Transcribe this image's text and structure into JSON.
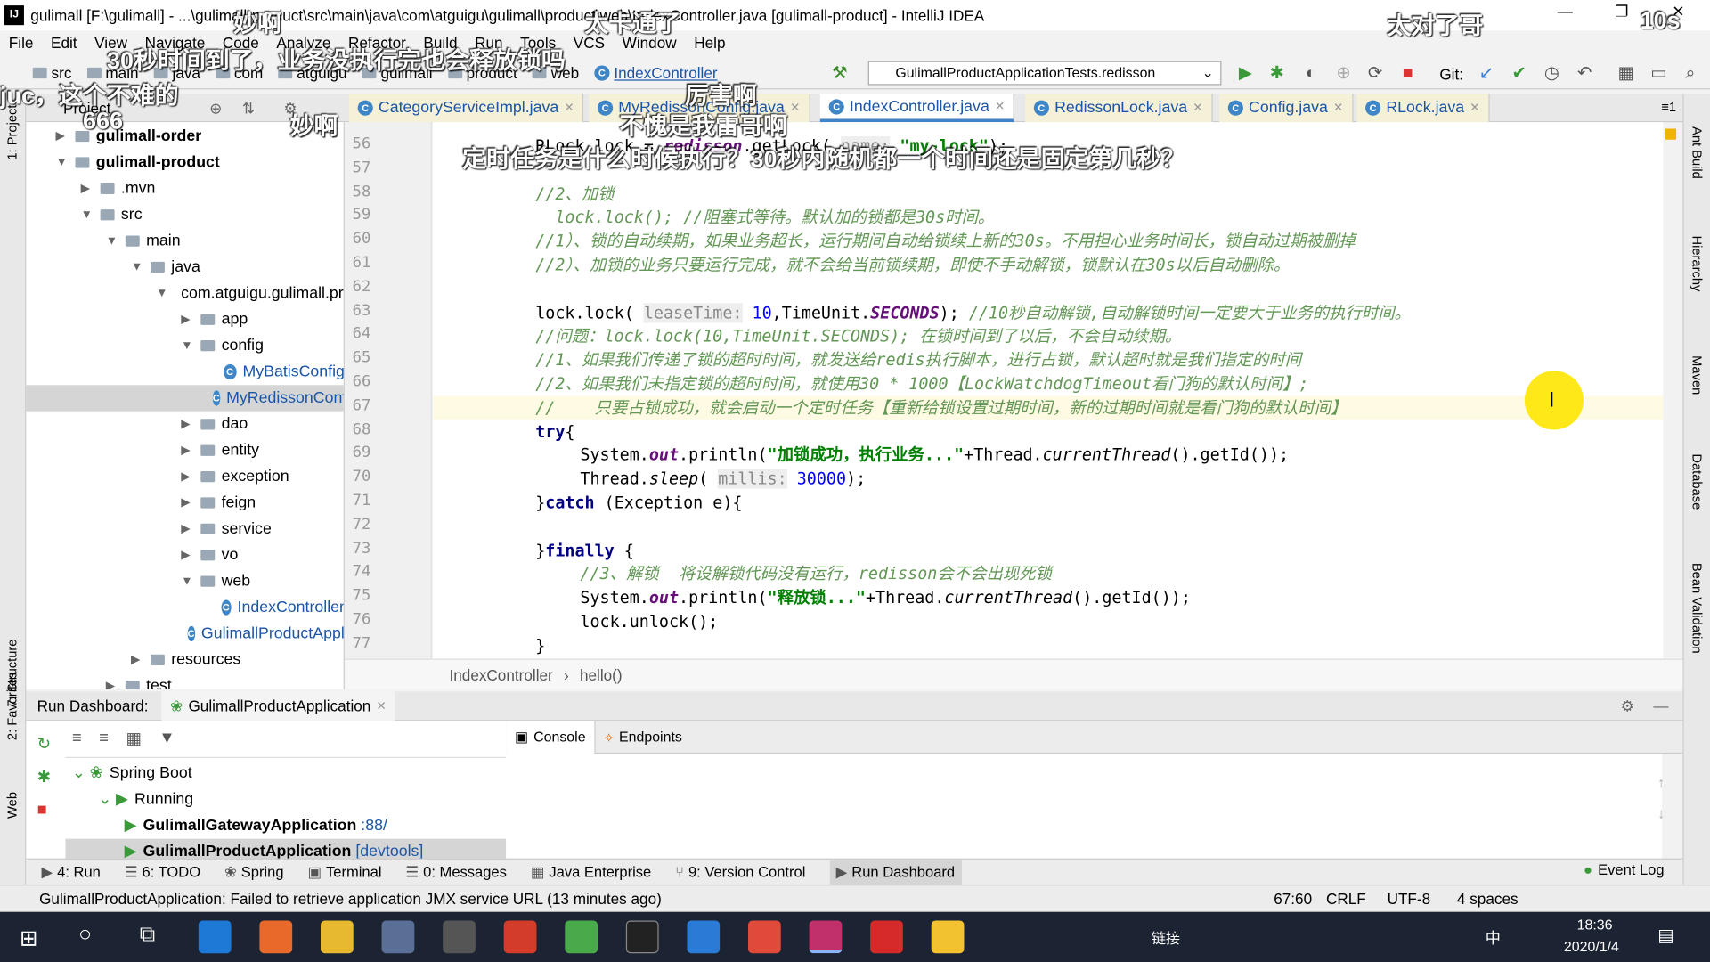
{
  "window": {
    "title": "gulimall [F:\\gulimall] - ...\\gulimall-product\\src\\main\\java\\com\\atguigu\\gulimall\\product\\web\\IndexController.java [gulimall-product] - IntelliJ IDEA",
    "minimize": "—",
    "maximize": "❐",
    "close": "✕"
  },
  "menu": [
    "File",
    "Edit",
    "View",
    "Navigate",
    "Code",
    "Analyze",
    "Refactor",
    "Build",
    "Run",
    "Tools",
    "VCS",
    "Window",
    "Help"
  ],
  "breadcrumbs": [
    "src",
    "main",
    "java",
    "com",
    "atguigu",
    "gulimall",
    "product",
    "web",
    "IndexController"
  ],
  "run_config": "GulimallProductApplicationTests.redisson",
  "git_label": "Git:",
  "left_strip": [
    "1: Project",
    "7: Structure",
    "2: Favorites",
    "Web"
  ],
  "right_strip": [
    "Ant Build",
    "Hierarchy",
    "Maven",
    "Database",
    "Bean Validation"
  ],
  "project": {
    "title": "Project",
    "tree": [
      {
        "label": "gulimall-order",
        "bold": true,
        "depth": 1,
        "arrow": "▶",
        "icon": "module"
      },
      {
        "label": "gulimall-product",
        "bold": true,
        "depth": 1,
        "arrow": "▼",
        "icon": "module"
      },
      {
        "label": ".mvn",
        "depth": 2,
        "arrow": "▶",
        "icon": "folder"
      },
      {
        "label": "src",
        "depth": 2,
        "arrow": "▼",
        "icon": "folder"
      },
      {
        "label": "main",
        "depth": 3,
        "arrow": "▼",
        "icon": "folder"
      },
      {
        "label": "java",
        "depth": 4,
        "arrow": "▼",
        "icon": "folder"
      },
      {
        "label": "com.atguigu.gulimall.product",
        "depth": 5,
        "arrow": "▼",
        "icon": "package"
      },
      {
        "label": "app",
        "depth": 6,
        "arrow": "▶",
        "icon": "package"
      },
      {
        "label": "config",
        "depth": 6,
        "arrow": "▼",
        "icon": "package"
      },
      {
        "label": "MyBatisConfig",
        "depth": 7,
        "arrow": "",
        "icon": "class"
      },
      {
        "label": "MyRedissonConfig",
        "depth": 7,
        "arrow": "",
        "icon": "class",
        "selected": true
      },
      {
        "label": "dao",
        "depth": 6,
        "arrow": "▶",
        "icon": "package"
      },
      {
        "label": "entity",
        "depth": 6,
        "arrow": "▶",
        "icon": "package"
      },
      {
        "label": "exception",
        "depth": 6,
        "arrow": "▶",
        "icon": "package"
      },
      {
        "label": "feign",
        "depth": 6,
        "arrow": "▶",
        "icon": "package"
      },
      {
        "label": "service",
        "depth": 6,
        "arrow": "▶",
        "icon": "package"
      },
      {
        "label": "vo",
        "depth": 6,
        "arrow": "▶",
        "icon": "package"
      },
      {
        "label": "web",
        "depth": 6,
        "arrow": "▼",
        "icon": "package"
      },
      {
        "label": "IndexController",
        "depth": 7,
        "arrow": "",
        "icon": "class"
      },
      {
        "label": "GulimallProductApplication",
        "depth": 6,
        "arrow": "",
        "icon": "class"
      },
      {
        "label": "resources",
        "depth": 4,
        "arrow": "▶",
        "icon": "folder"
      },
      {
        "label": "test",
        "depth": 3,
        "arrow": "▶",
        "icon": "folder"
      }
    ]
  },
  "tabs": [
    {
      "label": "CategoryServiceImpl.java"
    },
    {
      "label": "MyRedissonConfig.java"
    },
    {
      "label": "IndexController.java",
      "active": true
    },
    {
      "label": "RedissonLock.java"
    },
    {
      "label": "Config.java"
    },
    {
      "label": "RLock.java"
    }
  ],
  "tabs_overflow": "≡1",
  "code": [
    {
      "n": 56,
      "ind": 1,
      "t": [
        [
          "",
          "RLock lock = "
        ],
        [
          "f",
          "redisson"
        ],
        [
          "",
          ".getLock( "
        ],
        [
          "h",
          "name:"
        ],
        [
          "s",
          " \"my-lock\""
        ],
        [
          "",
          ");"
        ]
      ]
    },
    {
      "n": 57,
      "ind": 1,
      "t": []
    },
    {
      "n": 58,
      "ind": 1,
      "t": [
        [
          "c",
          "//2、加锁"
        ]
      ]
    },
    {
      "n": 59,
      "ind": 1,
      "pre": "//",
      "t": [
        [
          "c",
          "  lock.lock(); //阻塞式等待。默认加的锁都是30s时间。"
        ]
      ]
    },
    {
      "n": 60,
      "ind": 1,
      "t": [
        [
          "c",
          "//1）、锁的自动续期，如果业务超长，运行期间自动给锁续上新的30s。不用担心业务时间长，锁自动过期被删掉"
        ]
      ]
    },
    {
      "n": 61,
      "ind": 1,
      "t": [
        [
          "c",
          "//2）、加锁的业务只要运行完成，就不会给当前锁续期，即使不手动解锁，锁默认在30s以后自动删除。"
        ]
      ]
    },
    {
      "n": 62,
      "ind": 1,
      "t": []
    },
    {
      "n": 63,
      "ind": 1,
      "t": [
        [
          "",
          "lock.lock( "
        ],
        [
          "h",
          "leaseTime:"
        ],
        [
          "n",
          " 10"
        ],
        [
          "",
          ",TimeUnit."
        ],
        [
          "f",
          "SECONDS"
        ],
        [
          "",
          "); "
        ],
        [
          "c",
          "//10秒自动解锁,自动解锁时间一定要大于业务的执行时间。"
        ]
      ]
    },
    {
      "n": 64,
      "ind": 1,
      "t": [
        [
          "c",
          "//问题：lock.lock(10,TimeUnit.SECONDS); 在锁时间到了以后，不会自动续期。"
        ]
      ]
    },
    {
      "n": 65,
      "ind": 1,
      "t": [
        [
          "c",
          "//1、如果我们传递了锁的超时时间，就发送给redis执行脚本，进行占锁，默认超时就是我们指定的时间"
        ]
      ]
    },
    {
      "n": 66,
      "ind": 1,
      "t": [
        [
          "c",
          "//2、如果我们未指定锁的超时时间，就使用30 * 1000【LockWatchdogTimeout看门狗的默认时间】;"
        ]
      ]
    },
    {
      "n": 67,
      "ind": 1,
      "cur": true,
      "t": [
        [
          "c",
          "//    只要占锁成功，就会启动一个定时任务【重新给锁设置过期时间，新的过期时间就是看门狗的默认时间】"
        ]
      ]
    },
    {
      "n": 68,
      "ind": 1,
      "t": [
        [
          "k",
          "try"
        ],
        [
          "",
          "{"
        ]
      ]
    },
    {
      "n": 69,
      "ind": 2,
      "t": [
        [
          "",
          "System."
        ],
        [
          "f",
          "out"
        ],
        [
          "",
          ".println("
        ],
        [
          "s",
          "\"加锁成功，执行业务...\""
        ],
        [
          "",
          "+Thread."
        ],
        [
          "m",
          "currentThread"
        ],
        [
          "",
          "().getId());"
        ]
      ]
    },
    {
      "n": 70,
      "ind": 2,
      "t": [
        [
          "",
          "Thread."
        ],
        [
          "m",
          "sleep"
        ],
        [
          "",
          "( "
        ],
        [
          "h",
          "millis:"
        ],
        [
          "n",
          " 30000"
        ],
        [
          "",
          ");"
        ]
      ]
    },
    {
      "n": 71,
      "ind": 1,
      "t": [
        [
          "",
          "}"
        ],
        [
          "k",
          "catch"
        ],
        [
          "",
          " (Exception e){"
        ]
      ]
    },
    {
      "n": 72,
      "ind": 1,
      "t": []
    },
    {
      "n": 73,
      "ind": 1,
      "t": [
        [
          "",
          "}"
        ],
        [
          "k",
          "finally"
        ],
        [
          "",
          " {"
        ]
      ]
    },
    {
      "n": 74,
      "ind": 2,
      "t": [
        [
          "c",
          "//3、解锁  将设解锁代码没有运行，redisson会不会出现死锁"
        ]
      ]
    },
    {
      "n": 75,
      "ind": 2,
      "t": [
        [
          "",
          "System."
        ],
        [
          "f",
          "out"
        ],
        [
          "",
          ".println("
        ],
        [
          "s",
          "\"释放锁...\""
        ],
        [
          "",
          "+Thread."
        ],
        [
          "m",
          "currentThread"
        ],
        [
          "",
          "().getId());"
        ]
      ]
    },
    {
      "n": 76,
      "ind": 2,
      "t": [
        [
          "",
          "lock.unlock();"
        ]
      ]
    },
    {
      "n": 77,
      "ind": 1,
      "t": [
        [
          "",
          "}"
        ]
      ]
    }
  ],
  "editor_breadcrumb": [
    "IndexController",
    "hello()"
  ],
  "run_dashboard": {
    "title": "Run Dashboard:",
    "app_tab": "GulimallProductApplication",
    "tree": [
      {
        "label": "Spring Boot",
        "depth": 0
      },
      {
        "label": "Running",
        "depth": 1
      },
      {
        "label": "GulimallGatewayApplication",
        "suffix": " :88/",
        "depth": 2
      },
      {
        "label": "GulimallProductApplication",
        "suffix": " [devtools]",
        "depth": 2,
        "selected": true
      }
    ],
    "console_tabs": [
      "Console",
      "Endpoints"
    ]
  },
  "tool_windows": [
    "4: Run",
    "6: TODO",
    "Spring",
    "Terminal",
    "0: Messages",
    "Java Enterprise",
    "9: Version Control",
    "Run Dashboard"
  ],
  "event_log": "Event Log",
  "status": {
    "message": "GulimallProductApplication: Failed to retrieve application JMX service URL (13 minutes ago)",
    "position": "67:60",
    "line_sep": "CRLF",
    "encoding": "UTF-8",
    "indent": "4 spaces"
  },
  "taskbar": {
    "time": "18:36",
    "date": "2020/1/4",
    "ime": "中",
    "links": "链接"
  },
  "danmaku": [
    "妙啊",
    "太卡通了",
    "太对了哥",
    "10s",
    "30秒时间到了，业务没执行完也会释放锁吗",
    "juc，这个不难的",
    "厉害啊",
    "666",
    "妙啊",
    "不愧是我雷哥啊",
    "定时任务是什么时候执行？30秒内随机都一个时间还是固定第几秒？"
  ]
}
